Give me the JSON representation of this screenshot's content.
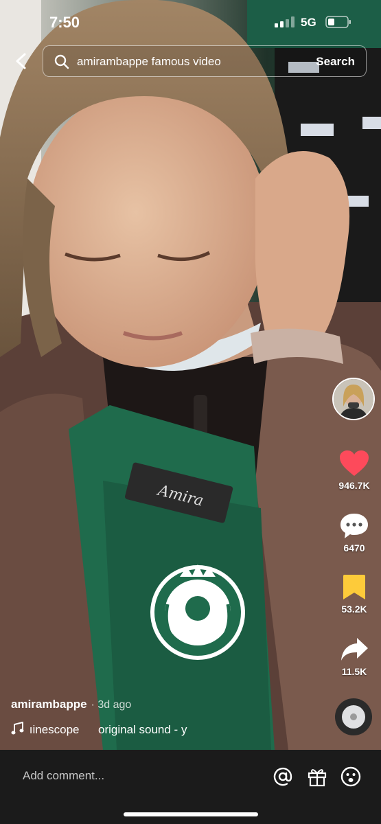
{
  "status_bar": {
    "time": "7:50",
    "network": "5G"
  },
  "search": {
    "query": "amirambappe famous video",
    "button_label": "Search"
  },
  "actions": {
    "likes": "946.7K",
    "comments": "6470",
    "saves": "53.2K",
    "shares": "11.5K"
  },
  "post": {
    "username": "amirambappe",
    "posted_ago": "· 3d ago",
    "sound_creator": "ıinescope",
    "sound_title": "original sound - y"
  },
  "comment_bar": {
    "placeholder": "Add comment..."
  },
  "colors": {
    "like": "#fd4a5b",
    "bookmark": "#fdcb3a",
    "apron": "#1f6b4c"
  },
  "icons": [
    "back-arrow-icon",
    "search-icon",
    "heart-icon",
    "comment-bubble-icon",
    "bookmark-icon",
    "share-arrow-icon",
    "music-note-icon",
    "at-icon",
    "gift-icon",
    "emoji-icon"
  ]
}
